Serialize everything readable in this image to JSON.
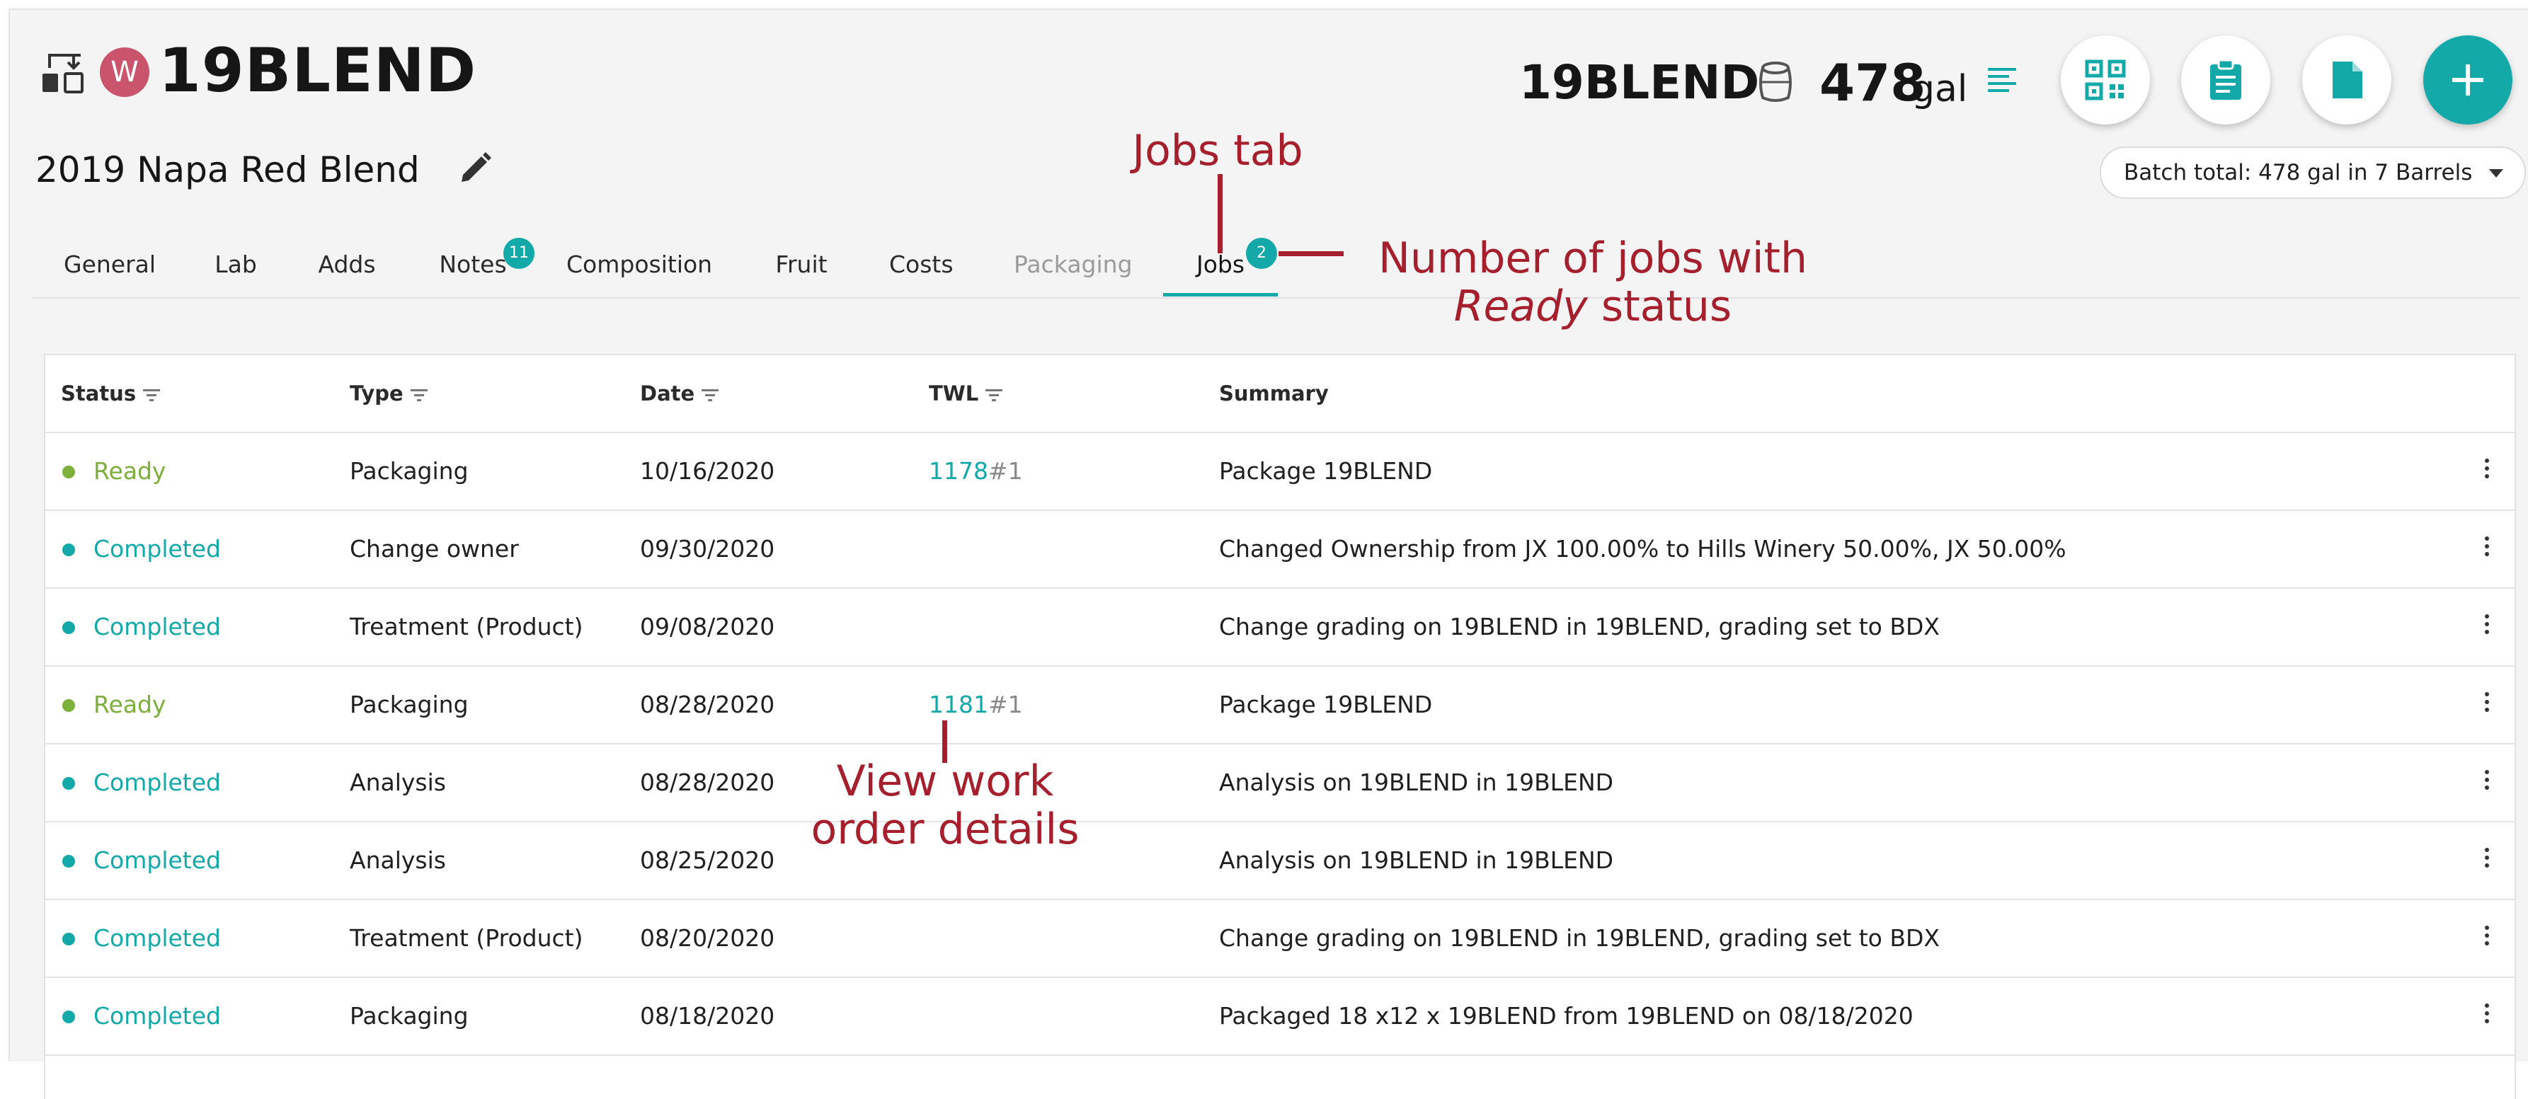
{
  "header": {
    "avatar_initial": "W",
    "title": "19BLEND",
    "subtitle": "2019 Napa Red Blend",
    "right_name": "19BLEND",
    "volume": "478",
    "volume_unit": "gal",
    "batch_total": "Batch total: 478 gal in 7 Barrels"
  },
  "tabs": [
    {
      "label": "General"
    },
    {
      "label": "Lab"
    },
    {
      "label": "Adds"
    },
    {
      "label": "Notes",
      "badge": "11"
    },
    {
      "label": "Composition"
    },
    {
      "label": "Fruit"
    },
    {
      "label": "Costs"
    },
    {
      "label": "Packaging"
    },
    {
      "label": "Jobs",
      "badge": "2",
      "active": true
    }
  ],
  "table": {
    "headers": [
      "Status",
      "Type",
      "Date",
      "TWL",
      "Summary"
    ],
    "rows": [
      {
        "status": "Ready",
        "type": "Packaging",
        "date": "10/16/2020",
        "twl": "1178",
        "twl_suffix": "#1",
        "summary": "Package 19BLEND"
      },
      {
        "status": "Completed",
        "type": "Change owner",
        "date": "09/30/2020",
        "twl": "",
        "twl_suffix": "",
        "summary": "Changed Ownership from JX 100.00% to Hills Winery 50.00%, JX 50.00%"
      },
      {
        "status": "Completed",
        "type": "Treatment (Product)",
        "date": "09/08/2020",
        "twl": "",
        "twl_suffix": "",
        "summary": "Change grading on 19BLEND in 19BLEND, grading set to BDX"
      },
      {
        "status": "Ready",
        "type": "Packaging",
        "date": "08/28/2020",
        "twl": "1181",
        "twl_suffix": "#1",
        "summary": "Package 19BLEND"
      },
      {
        "status": "Completed",
        "type": "Analysis",
        "date": "08/28/2020",
        "twl": "",
        "twl_suffix": "",
        "summary": "Analysis on 19BLEND in 19BLEND"
      },
      {
        "status": "Completed",
        "type": "Analysis",
        "date": "08/25/2020",
        "twl": "",
        "twl_suffix": "",
        "summary": "Analysis on 19BLEND in 19BLEND"
      },
      {
        "status": "Completed",
        "type": "Treatment (Product)",
        "date": "08/20/2020",
        "twl": "",
        "twl_suffix": "",
        "summary": "Change grading on 19BLEND in 19BLEND, grading set to BDX"
      },
      {
        "status": "Completed",
        "type": "Packaging",
        "date": "08/18/2020",
        "twl": "",
        "twl_suffix": "",
        "summary": "Packaged 18 x12 x 19BLEND from 19BLEND on 08/18/2020"
      }
    ]
  },
  "annotations": {
    "jobs_tab": "Jobs tab",
    "ready_count_line1": "Number of jobs with",
    "ready_count_italic": "Ready",
    "ready_count_rest": "status",
    "work_order_line1": "View work",
    "work_order_line2": "order details"
  },
  "colors": {
    "accent": "#14a9a9",
    "ready": "#7cb03a",
    "annotation": "#a51f2d",
    "avatar": "#c9546b"
  }
}
